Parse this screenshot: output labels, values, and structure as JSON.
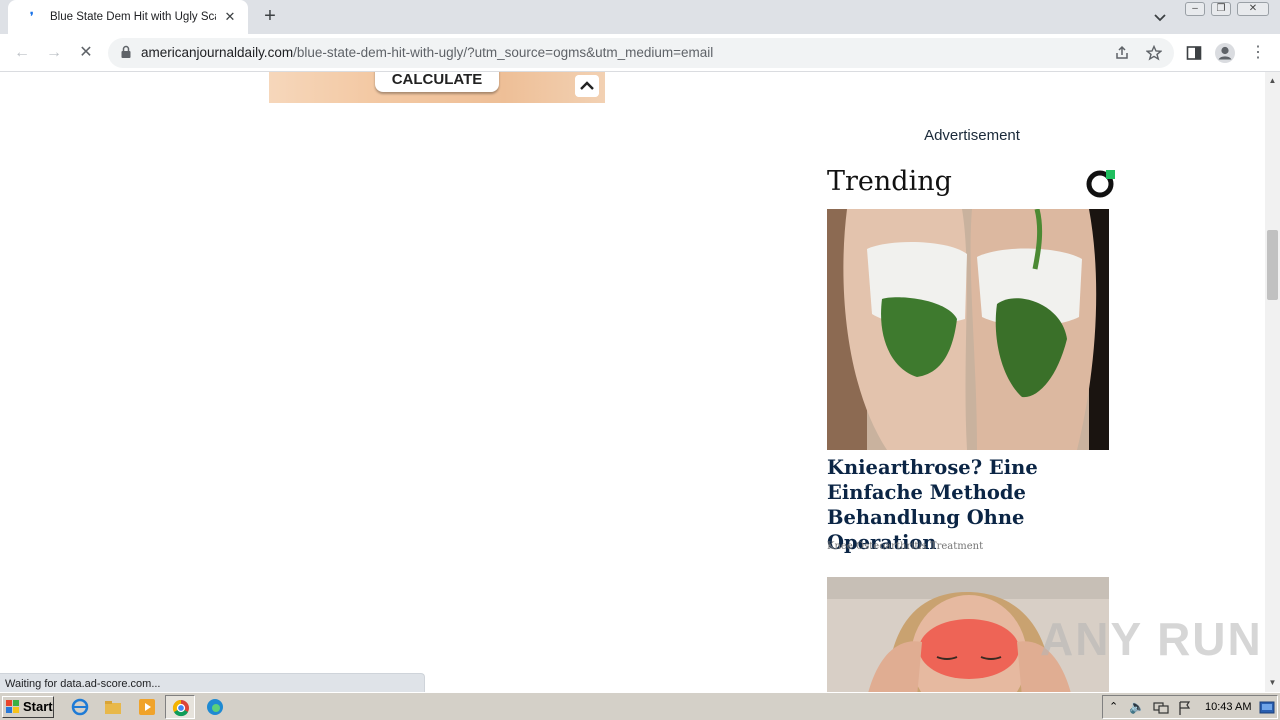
{
  "browser": {
    "tab_title": "Blue State Dem Hit with Ugly Scanda",
    "new_tab_label": "+",
    "url_host": "americanjournaldaily.com",
    "url_path": "/blue-state-dem-hit-with-ugly/?utm_source=ogms&utm_medium=email",
    "status_text": "Waiting for data.ad-score.com..."
  },
  "page": {
    "ad_button_label": "CALCULATE",
    "advertisement_label": "Advertisement",
    "trending_title": "Trending",
    "card1": {
      "title": "Kniearthrose? Eine Einfache Methode Behandlung Ohne Operation",
      "source": "Knee Osteoarthritis Treatment"
    }
  },
  "watermark": "ANY RUN",
  "taskbar": {
    "start_label": "Start",
    "clock": "10:43 AM"
  },
  "colors": {
    "accent": "#1a73e8",
    "headline": "#0b2545",
    "tab_strip": "#dee1e6"
  }
}
